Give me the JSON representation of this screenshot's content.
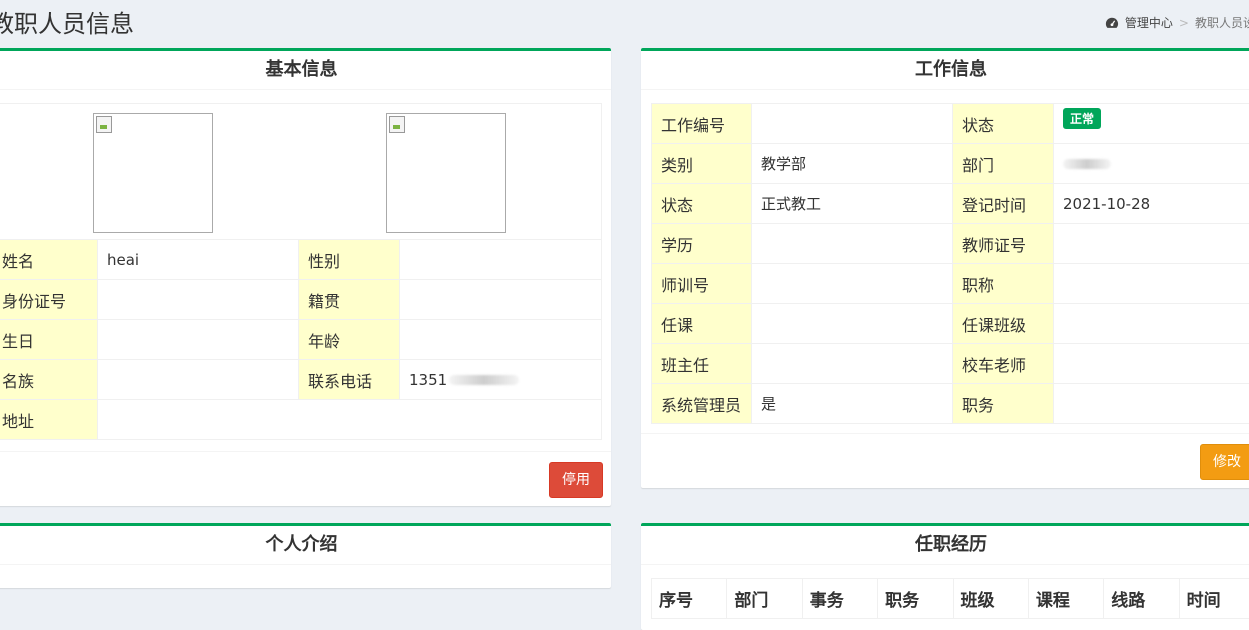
{
  "page": {
    "title": "教职人员信息"
  },
  "breadcrumb": {
    "home": "管理中心",
    "current": "教职人员设"
  },
  "basic_info": {
    "title": "基本信息",
    "rows": [
      {
        "label1": "姓名",
        "value1": "heai",
        "label2": "性别",
        "value2": ""
      },
      {
        "label1": "身份证号",
        "value1": "",
        "label2": "籍贯",
        "value2": ""
      },
      {
        "label1": "生日",
        "value1": "",
        "label2": "年龄",
        "value2": ""
      },
      {
        "label1": "名族",
        "value1": "",
        "label2": "联系电话",
        "value2": "1351"
      }
    ],
    "address_label": "地址",
    "address_value": "",
    "disable_button": "停用"
  },
  "work_info": {
    "title": "工作信息",
    "rows": [
      {
        "label1": "工作编号",
        "value1": "",
        "label2": "状态",
        "value2": ""
      },
      {
        "label1": "类别",
        "value1": "教学部",
        "label2": "部门",
        "value2": ""
      },
      {
        "label1": "状态",
        "value1": "正式教工",
        "label2": "登记时间",
        "value2": "2021-10-28"
      },
      {
        "label1": "学历",
        "value1": "",
        "label2": "教师证号",
        "value2": ""
      },
      {
        "label1": "师训号",
        "value1": "",
        "label2": "职称",
        "value2": ""
      },
      {
        "label1": "任课",
        "value1": "",
        "label2": "任课班级",
        "value2": ""
      },
      {
        "label1": "班主任",
        "value1": "",
        "label2": "校车老师",
        "value2": ""
      },
      {
        "label1": "系统管理员",
        "value1": "是",
        "label2": "职务",
        "value2": ""
      }
    ],
    "status_badge": "正常",
    "edit_button": "修改"
  },
  "intro": {
    "title": "个人介绍"
  },
  "history": {
    "title": "任职经历",
    "columns": [
      "序号",
      "部门",
      "事务",
      "职务",
      "班级",
      "课程",
      "线路",
      "时间"
    ]
  },
  "colors": {
    "accent_green": "#00a65a",
    "label_bg": "#ffffcc",
    "danger": "#dd4b39",
    "warning": "#f39c12",
    "page_bg": "#ecf0f5"
  }
}
